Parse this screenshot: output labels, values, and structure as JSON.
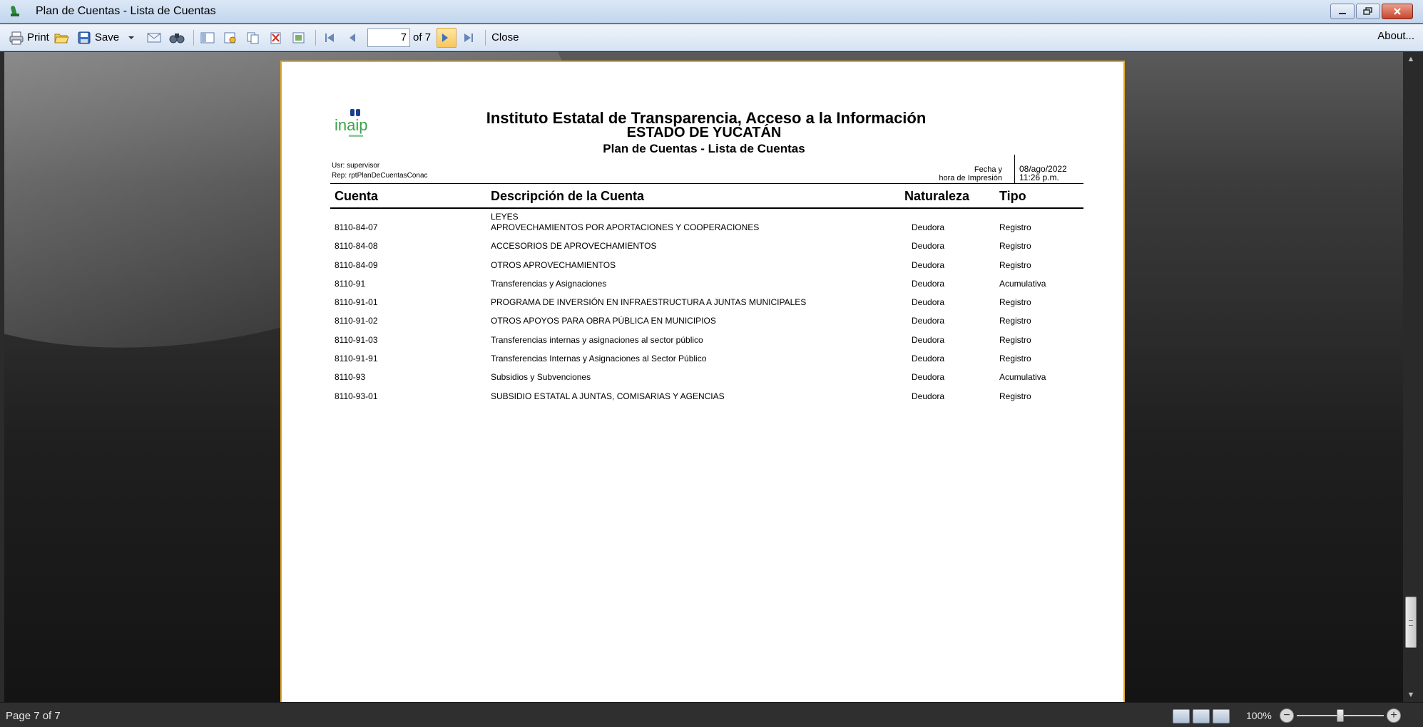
{
  "window": {
    "title": "Plan de Cuentas - Lista de Cuentas"
  },
  "toolbar": {
    "print_label": "Print",
    "save_label": "Save",
    "page_value": "7",
    "page_of": "of 7",
    "close_label": "Close",
    "about_label": "About..."
  },
  "report": {
    "logo_text": "inaip",
    "title_line1": "Instituto Estatal de Transparencia, Acceso a la Información",
    "title_line2": "ESTADO DE YUCATÁN",
    "title_line3": "Plan de Cuentas - Lista de Cuentas",
    "user": "Usr: supervisor",
    "rep": "Rep: rptPlanDeCuentasConac",
    "fecha_label": "Fecha y",
    "hora_label": "hora de Impresión",
    "fecha_value": "08/ago/2022",
    "hora_value": "11:26 p.m.",
    "headers": {
      "cuenta": "Cuenta",
      "descripcion": "Descripción de la Cuenta",
      "naturaleza": "Naturaleza",
      "tipo": "Tipo"
    },
    "orphan_text": "LEYES",
    "rows": [
      {
        "cuenta": "8110-84-07",
        "descripcion": "APROVECHAMIENTOS POR APORTACIONES Y COOPERACIONES",
        "naturaleza": "Deudora",
        "tipo": "Registro"
      },
      {
        "cuenta": "8110-84-08",
        "descripcion": "ACCESORIOS DE APROVECHAMIENTOS",
        "naturaleza": "Deudora",
        "tipo": "Registro"
      },
      {
        "cuenta": "8110-84-09",
        "descripcion": "OTROS APROVECHAMIENTOS",
        "naturaleza": "Deudora",
        "tipo": "Registro"
      },
      {
        "cuenta": "8110-91",
        "descripcion": "Transferencias y Asignaciones",
        "naturaleza": "Deudora",
        "tipo": "Acumulativa"
      },
      {
        "cuenta": "8110-91-01",
        "descripcion": "PROGRAMA DE INVERSIÓN EN INFRAESTRUCTURA A JUNTAS MUNICIPALES",
        "naturaleza": "Deudora",
        "tipo": "Registro"
      },
      {
        "cuenta": "8110-91-02",
        "descripcion": "OTROS APOYOS PARA OBRA PÚBLICA EN MUNICIPIOS",
        "naturaleza": "Deudora",
        "tipo": "Registro"
      },
      {
        "cuenta": "8110-91-03",
        "descripcion": "Transferencias internas y asignaciones al sector público",
        "naturaleza": "Deudora",
        "tipo": "Registro"
      },
      {
        "cuenta": "8110-91-91",
        "descripcion": "Transferencias Internas y Asignaciones al Sector Público",
        "naturaleza": "Deudora",
        "tipo": "Registro"
      },
      {
        "cuenta": "8110-93",
        "descripcion": "Subsidios y Subvenciones",
        "naturaleza": "Deudora",
        "tipo": "Acumulativa"
      },
      {
        "cuenta": "8110-93-01",
        "descripcion": "SUBSIDIO ESTATAL A JUNTAS, COMISARIAS Y AGENCIAS",
        "naturaleza": "Deudora",
        "tipo": "Registro"
      }
    ]
  },
  "statusbar": {
    "page_text": "Page 7 of 7",
    "zoom_text": "100%"
  }
}
